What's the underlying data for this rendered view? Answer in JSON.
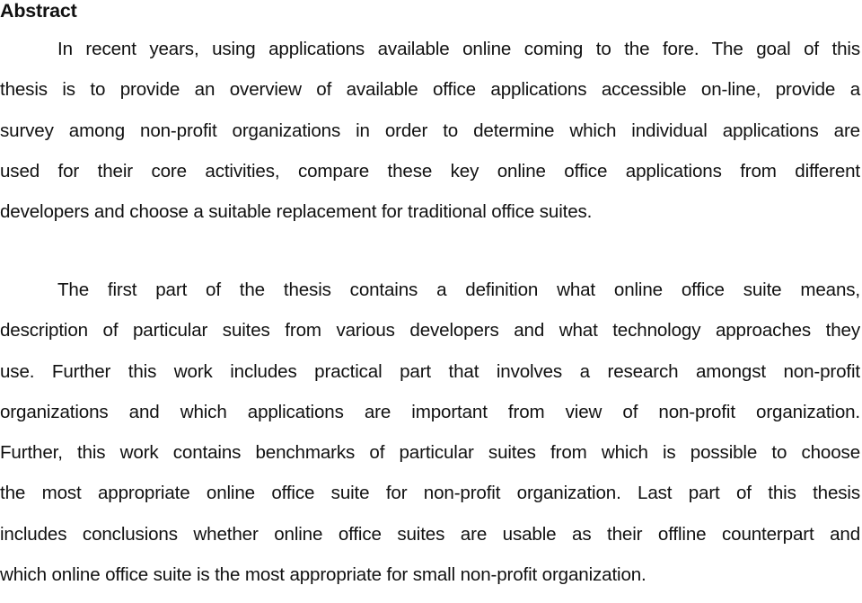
{
  "document": {
    "heading": "Abstract",
    "paragraphs": [
      {
        "lines": [
          "In recent years, using applications available online coming to the fore. The goal of this",
          "thesis is to provide an overview of available office applications accessible on-line, provide a",
          "survey among non-profit organizations in order to determine which individual applications are",
          "used for their core activities, compare these key online office applications from different",
          "developers and choose a suitable replacement for traditional office suites."
        ]
      },
      {
        "lines": [
          "The first part of the thesis contains a definition what online office suite means,",
          "description of particular suites from various developers and what technology approaches they",
          "use. Further this work includes practical part that involves a research amongst non-profit",
          "organizations and which applications are important from view of non-profit organization.",
          "Further, this work contains benchmarks of particular suites from which is possible to choose",
          "the most appropriate online office suite for non-profit organization. Last part of this thesis",
          "includes conclusions whether online office suites are usable as their offline counterpart and",
          "which online office suite is the most appropriate for small non-profit organization."
        ]
      }
    ]
  }
}
